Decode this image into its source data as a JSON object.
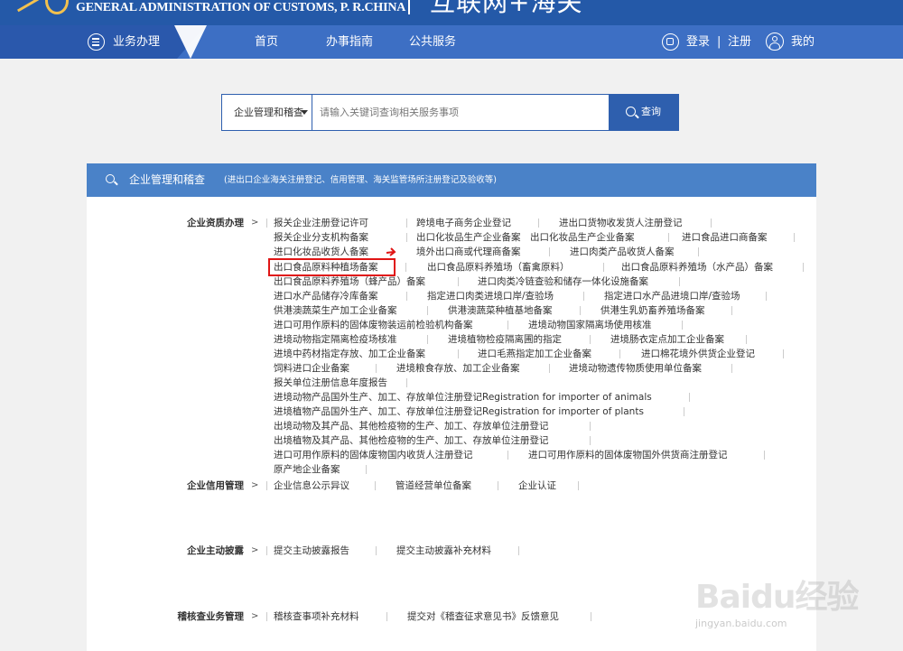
{
  "header": {
    "org_name": "GENERAL ADMINISTRATION OF CUSTOMS, P. R.CHINA",
    "brand": "互联网+海关"
  },
  "nav": {
    "items": [
      {
        "label": "业务办理"
      },
      {
        "label": "首页"
      },
      {
        "label": "办事指南"
      },
      {
        "label": "公共服务"
      }
    ],
    "login": "登录",
    "divider": "|",
    "register": "注册",
    "mine": "我的"
  },
  "search": {
    "category": "企业管理和稽查",
    "placeholder": "请输入关键词查询相关服务事项",
    "button": "查询"
  },
  "panel": {
    "title": "企业管理和稽查",
    "subtitle": "(进出口企业海关注册登记、信用管理、海关监管场所注册登记及验收等)",
    "arrow": ">",
    "categories": [
      {
        "label": "企业资质办理",
        "items": [
          "报关企业注册登记许可",
          "跨境电子商务企业登记",
          "进出口货物收发货人注册登记",
          "报关企业分支机构备案",
          "出口化妆品生产企业备案",
          "出口化妆品生产企业备案",
          "进口食品进口商备案",
          "进口化妆品收货人备案",
          "境外出口商或代理商备案",
          "进口肉类产品收货人备案",
          "出口食品原料种植场备案",
          "出口食品原料养殖场（畜禽原料）",
          "出口食品原料养殖场（水产品）备案",
          "出口食品原料养殖场（蜂产品）备案",
          "进口肉类冷链查验和储存一体化设施备案",
          "进口水产品储存冷库备案",
          "指定进口肉类进境口岸/查验场",
          "指定进口水产品进境口岸/查验场",
          "供港澳蔬菜生产加工企业备案",
          "供港澳蔬菜种植基地备案",
          "供港生乳奶畜养殖场备案",
          "进口可用作原料的固体废物装运前检验机构备案",
          "进境动物国家隔离场使用核准",
          "进境动物指定隔离检疫场核准",
          "进境植物检疫隔离圃的指定",
          "进境肠衣定点加工企业备案",
          "进境中药材指定存放、加工企业备案",
          "进口毛燕指定加工企业备案",
          "进口棉花境外供货企业登记",
          "饲料进口企业备案",
          "进境粮食存放、加工企业备案",
          "进境动物遗传物质使用单位备案",
          "报关单位注册信息年度报告",
          "进境动物产品国外生产、加工、存放单位注册登记Registration for importer of animals",
          "进境植物产品国外生产、加工、存放单位注册登记Registration for importer of plants",
          "出境动物及其产品、其他检疫物的生产、加工、存放单位注册登记",
          "出境植物及其产品、其他检疫物的生产、加工、存放单位注册登记",
          "进口可用作原料的固体废物国内收货人注册登记",
          "进口可用作原料的固体废物国外供货商注册登记",
          "原产地企业备案"
        ]
      },
      {
        "label": "企业信用管理",
        "items": [
          "企业信息公示异议",
          "管道经营单位备案",
          "企业认证"
        ]
      },
      {
        "label": "企业主动披露",
        "items": [
          "提交主动披露报告",
          "提交主动披露补充材料"
        ]
      },
      {
        "label": "稽核查业务管理",
        "items": [
          "稽核查事项补充材料",
          "提交对《稽查征求意见书》反馈意见"
        ]
      }
    ]
  },
  "watermark": {
    "text": "Baidu经验",
    "url": "jingyan.baidu.com"
  },
  "colors": {
    "header_blue": "#2459a8",
    "nav_blue": "#3d6fc4",
    "panel_head": "#4a82c8",
    "highlight": "#e01515"
  },
  "icons": [
    "emblem-icon",
    "menu-icon",
    "login-icon",
    "user-icon",
    "search-icon"
  ]
}
